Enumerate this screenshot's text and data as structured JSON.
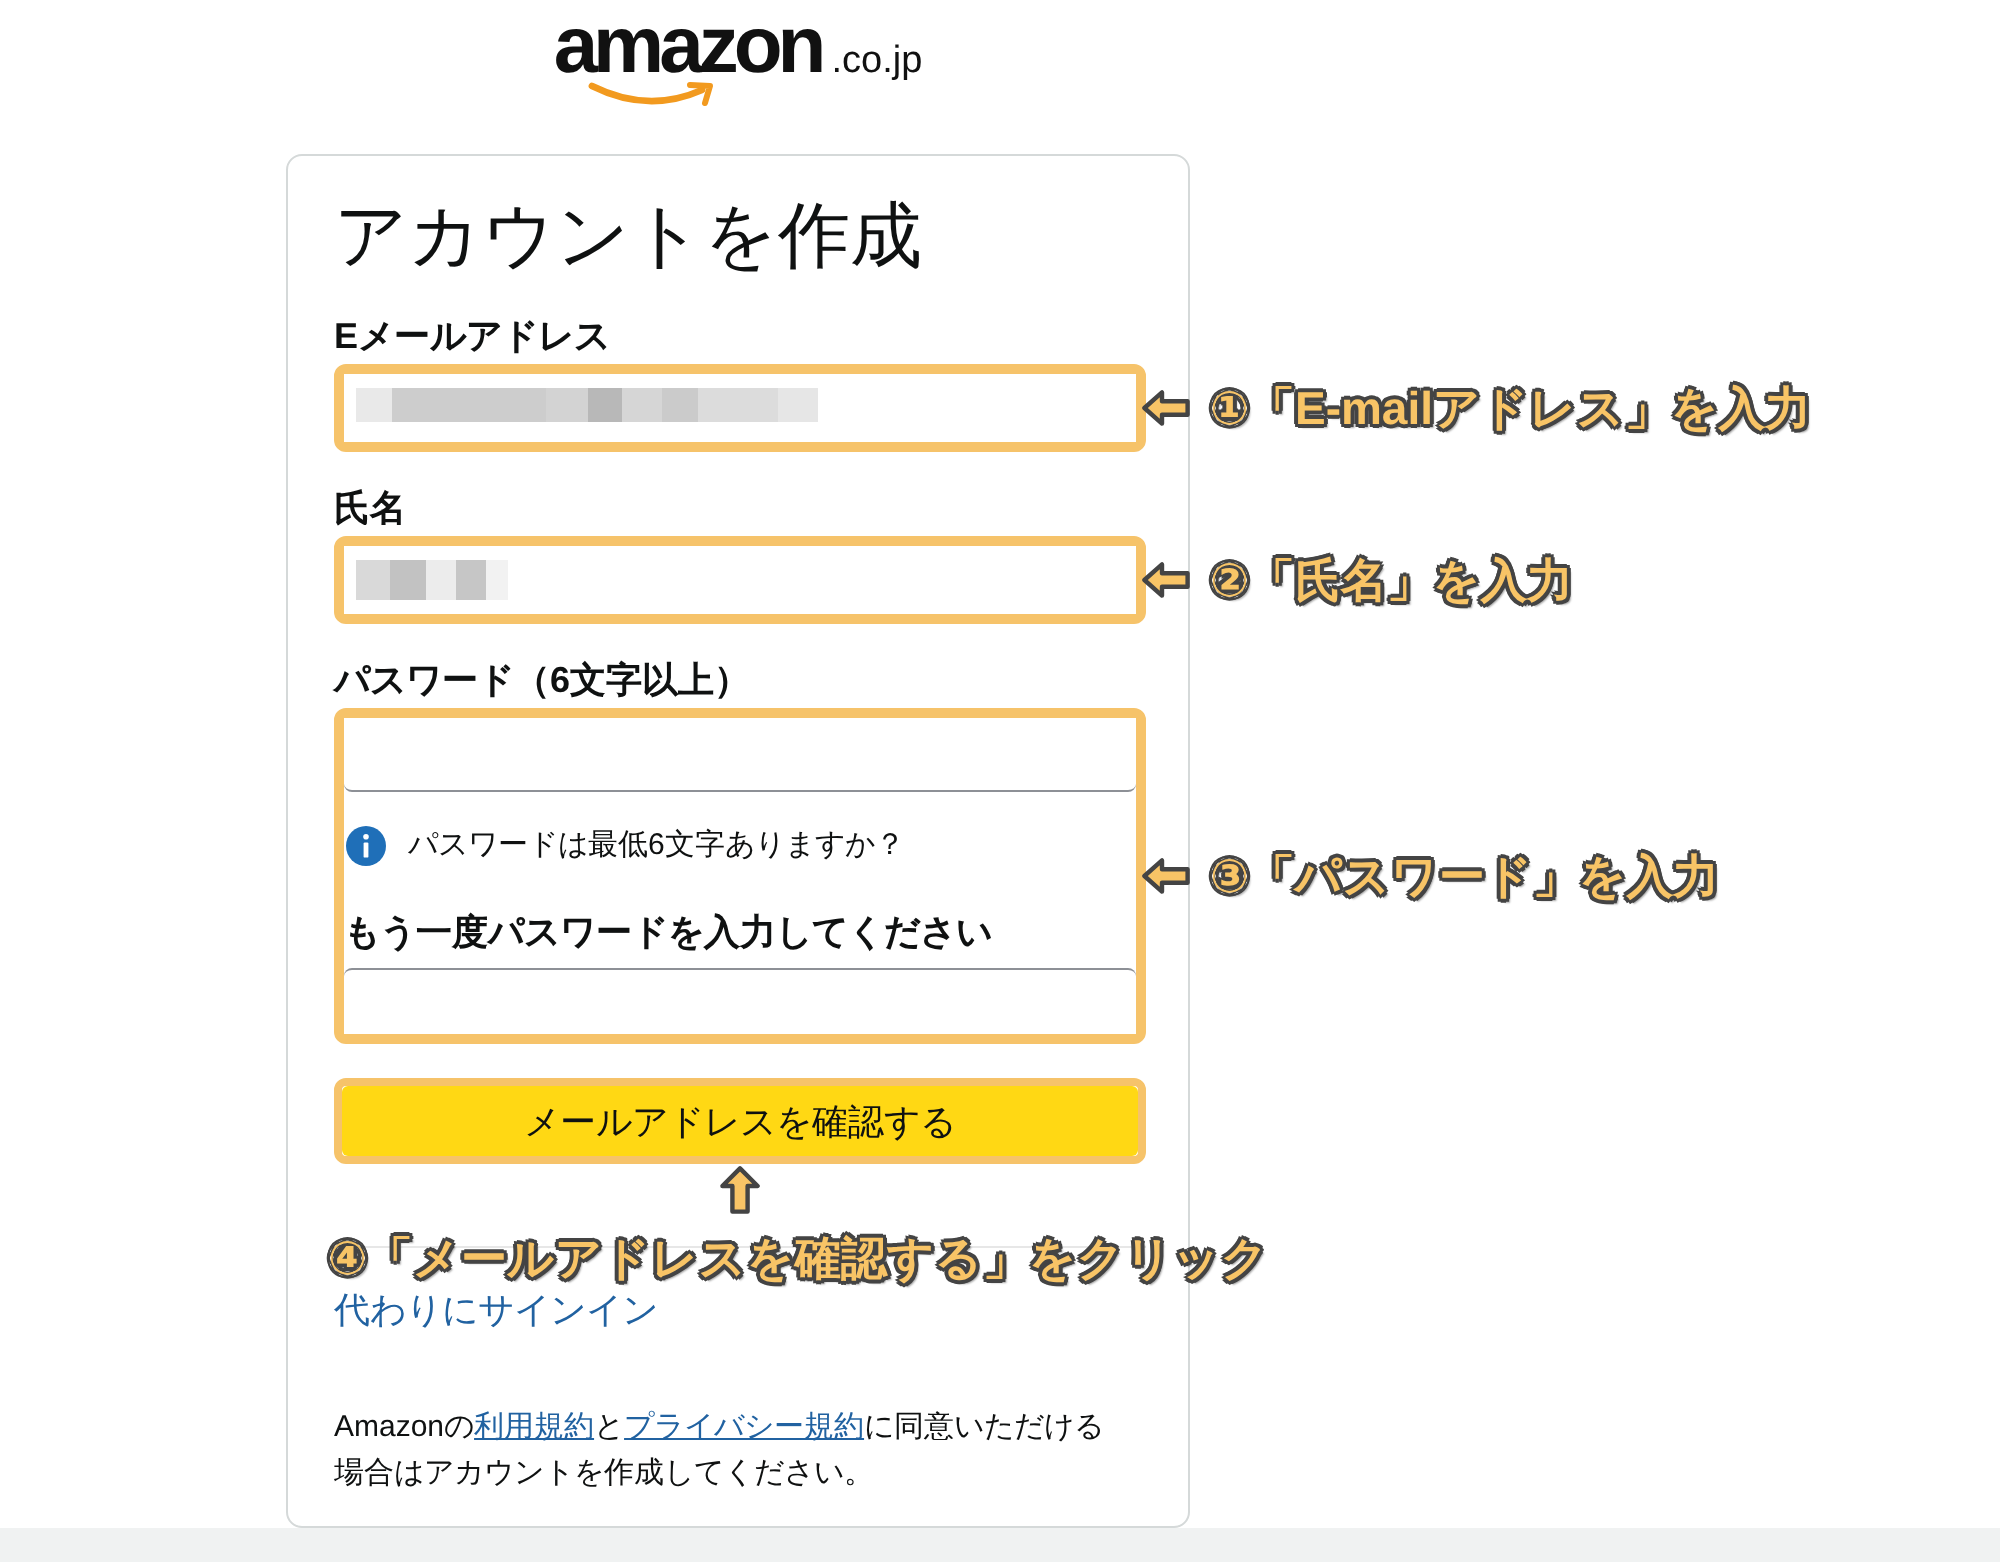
{
  "logo": {
    "wordmark": "amazon",
    "domain": ".co.jp"
  },
  "form": {
    "title": "アカウントを作成",
    "fields": [
      {
        "kind": "text",
        "label": "Eメールアドレス",
        "value_redacted": true,
        "annotation": "①「E-mailアドレス」を入力"
      },
      {
        "kind": "text",
        "label": "氏名",
        "value_redacted": true,
        "annotation": "②「氏名」を入力"
      },
      {
        "kind": "password_group",
        "label": "パスワード（6文字以上）",
        "hint": "パスワードは最低6文字ありますか？",
        "confirm_label": "もう一度パスワードを入力してください",
        "annotation": "③「パスワード」を入力"
      }
    ],
    "submit": {
      "label": "メールアドレスを確認する",
      "annotation": "④「メールアドレスを確認する」をクリック"
    },
    "sign_in_link": "代わりにサインイン",
    "legal_text": [
      {
        "kind": "text",
        "text": "Amazonの"
      },
      {
        "kind": "link",
        "text": "利用規約"
      },
      {
        "kind": "text",
        "text": "と"
      },
      {
        "kind": "link",
        "text": "プライバシー規約"
      },
      {
        "kind": "text",
        "text": "に同意いただける場合はアカウントを作成してください。"
      }
    ]
  }
}
